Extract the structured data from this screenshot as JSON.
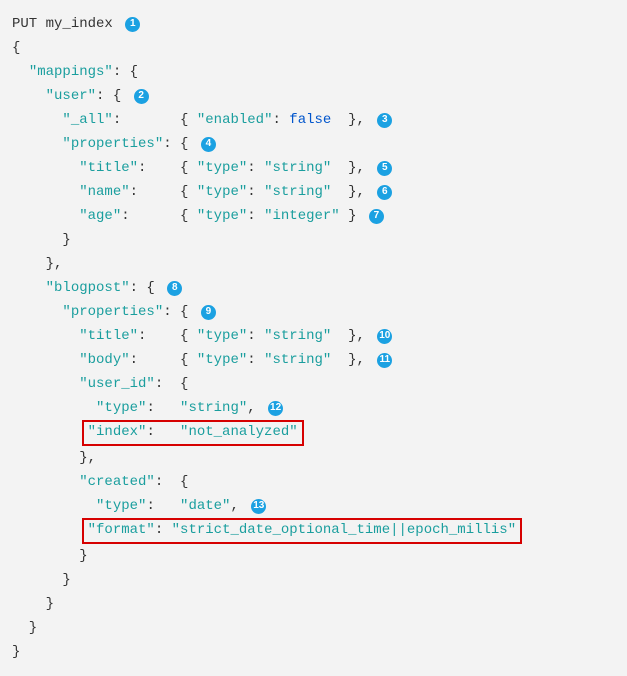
{
  "request": {
    "method": "PUT",
    "target": "my_index"
  },
  "tokens": {
    "mappings": "\"mappings\"",
    "user": "\"user\"",
    "_all": "\"_all\"",
    "enabled": "\"enabled\"",
    "false": "false",
    "properties": "\"properties\"",
    "title": "\"title\"",
    "type": "\"type\"",
    "string": "\"string\"",
    "name": "\"name\"",
    "age": "\"age\"",
    "integer": "\"integer\"",
    "blogpost": "\"blogpost\"",
    "body": "\"body\"",
    "user_id": "\"user_id\"",
    "index": "\"index\"",
    "not_analyzed": "\"not_analyzed\"",
    "created": "\"created\"",
    "date": "\"date\"",
    "format": "\"format\"",
    "format_value": "\"strict_date_optional_time||epoch_millis\""
  },
  "callouts": {
    "c1": "1",
    "c2": "2",
    "c3": "3",
    "c4": "4",
    "c5": "5",
    "c6": "6",
    "c7": "7",
    "c8": "8",
    "c9": "9",
    "c10": "10",
    "c11": "11",
    "c12": "12",
    "c13": "13"
  },
  "highlights": [
    {
      "line": "\"index\":   \"not_analyzed\""
    },
    {
      "line": "\"format\": \"strict_date_optional_time||epoch_millis\""
    }
  ]
}
